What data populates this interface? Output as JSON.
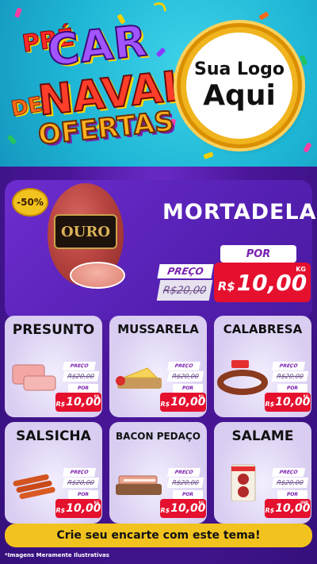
{
  "header": {
    "title_pre": "PRÉ",
    "title_car": "CAR",
    "title_de": "DE",
    "title_naval": "NAVAL",
    "title_ofertas": "OFERTAS",
    "logo_line1": "Sua Logo",
    "logo_line2": "Aqui"
  },
  "hero": {
    "discount": "-50%",
    "brand_label": "OURO",
    "name": "MORTADELA",
    "preco_label": "PREÇO",
    "old_price": "R$20,00",
    "por_label": "POR",
    "currency": "R$",
    "new_price": "10,00",
    "unit": "KG"
  },
  "products": [
    {
      "name": "PRESUNTO",
      "preco_label": "PREÇO",
      "old_price": "R$20,00",
      "por_label": "POR",
      "currency": "R$",
      "new_price": "10,00",
      "unit": "KG"
    },
    {
      "name": "MUSSARELA",
      "preco_label": "PREÇO",
      "old_price": "R$20,00",
      "por_label": "POR",
      "currency": "R$",
      "new_price": "10,00",
      "unit": "KG"
    },
    {
      "name": "CALABRESA",
      "preco_label": "PREÇO",
      "old_price": "R$20,00",
      "por_label": "POR",
      "currency": "R$",
      "new_price": "10,00",
      "unit": "KG"
    },
    {
      "name": "SALSICHA",
      "preco_label": "PREÇO",
      "old_price": "R$20,00",
      "por_label": "POR",
      "currency": "R$",
      "new_price": "10,00",
      "unit": "KG"
    },
    {
      "name": "BACON PEDAÇO",
      "preco_label": "PREÇO",
      "old_price": "R$20,00",
      "por_label": "POR",
      "currency": "R$",
      "new_price": "10,00",
      "unit": "KG"
    },
    {
      "name": "SALAME",
      "preco_label": "PREÇO",
      "old_price": "R$20,00",
      "por_label": "POR",
      "currency": "R$",
      "new_price": "10,00",
      "unit": "UND"
    }
  ],
  "footer": {
    "banner": "Crie seu encarte com este tema!",
    "disclaimer": "*Imagens Meramente Ilustrativas"
  },
  "colors": {
    "header_bg": "#1fb7d6",
    "main_bg": "#4b169a",
    "price_red": "#e5102e",
    "gold": "#f2c21f",
    "purple_text": "#7a1fb0"
  }
}
